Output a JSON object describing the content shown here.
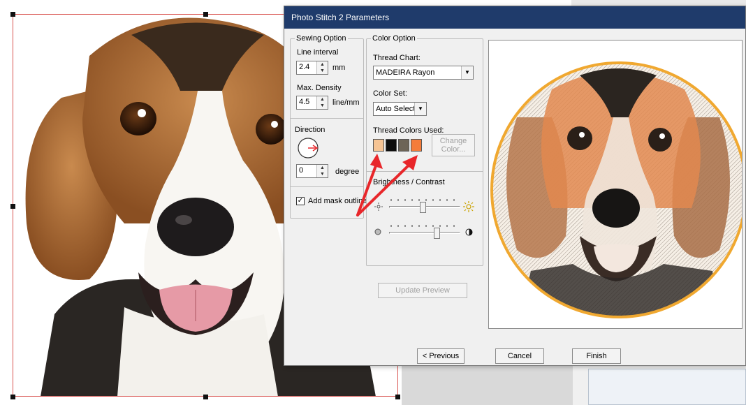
{
  "dialog": {
    "title": "Photo Stitch 2 Parameters",
    "sewing_option": {
      "title": "Sewing Option",
      "line_interval_label": "Line interval",
      "line_interval_value": "2.4",
      "line_interval_unit": "mm",
      "max_density_label": "Max. Density",
      "max_density_value": "4.5",
      "max_density_unit": "line/mm",
      "direction_label": "Direction",
      "degree_value": "0",
      "degree_unit": "degree",
      "add_mask_outline_label": "Add mask outline",
      "add_mask_outline_checked": true
    },
    "color_option": {
      "title": "Color Option",
      "thread_chart_label": "Thread Chart:",
      "thread_chart_value": "MADEIRA Rayon",
      "color_set_label": "Color Set:",
      "color_set_value": "Auto Select",
      "thread_colors_label": "Thread Colors Used:",
      "thread_colors": [
        "#f6c494",
        "#0d0d0d",
        "#6d6457",
        "#f57c3a"
      ],
      "change_color_label_1": "Change",
      "change_color_label_2": "Color...",
      "brightness_contrast_label": "Brightness / Contrast",
      "update_preview_label": "Update Preview"
    },
    "buttons": {
      "previous": "< Previous",
      "cancel": "Cancel",
      "finish": "Finish"
    }
  },
  "colors": {
    "selection_border": "#d9534f",
    "titlebar": "#1f3b6b",
    "arrow": "#e8262a",
    "hoop_outline": "#f0a830"
  },
  "icons": [
    "sun-small-icon",
    "sun-large-icon",
    "contrast-low-icon",
    "contrast-high-icon",
    "direction-dial-icon",
    "red-arrow-annotation"
  ]
}
